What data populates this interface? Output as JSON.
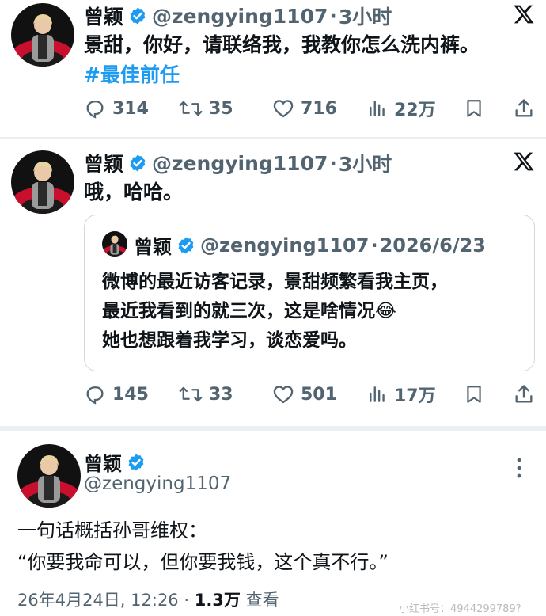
{
  "tweets": [
    {
      "author": "曾颖",
      "handle": "@zengying1107",
      "separator": "·",
      "time": "3小时",
      "text_line1": "景甜，你好，请联络我，我教你怎么洗内裤。",
      "hashtag": "#最佳前任",
      "replies": "314",
      "retweets": "35",
      "likes": "716",
      "views": "22万"
    },
    {
      "author": "曾颖",
      "handle": "@zengying1107",
      "separator": "·",
      "time": "3小时",
      "text_line1": "哦，哈哈。",
      "quote": {
        "author": "曾颖",
        "handle": "@zengying1107",
        "separator": "·",
        "date": "2026/6/23",
        "line1": "微博的最近访客记录，景甜频繁看我主页，",
        "line2": "最近我看到的就三次，这是啥情况😂",
        "line3": "她也想跟着我学习，谈恋爱吗。"
      },
      "replies": "145",
      "retweets": "33",
      "likes": "501",
      "views": "17万"
    },
    {
      "author": "曾颖",
      "handle": "@zengying1107",
      "line1": "一句话概括孙哥维权：",
      "line2": "“你要我命可以，但你要我钱，这个真不行。”",
      "meta_time": "26年4月24日, 12:26 · ",
      "meta_views": "1.3万",
      "meta_views_label": " 查看"
    }
  ],
  "watermark": "小红书号：4944299789?",
  "colors": {
    "accent": "#1d9bf0",
    "muted": "#536471",
    "text": "#0f1419"
  },
  "icons": [
    "verified-badge-icon",
    "x-logo-icon",
    "reply-icon",
    "retweet-icon",
    "like-icon",
    "views-icon",
    "bookmark-icon",
    "share-icon",
    "more-icon"
  ]
}
